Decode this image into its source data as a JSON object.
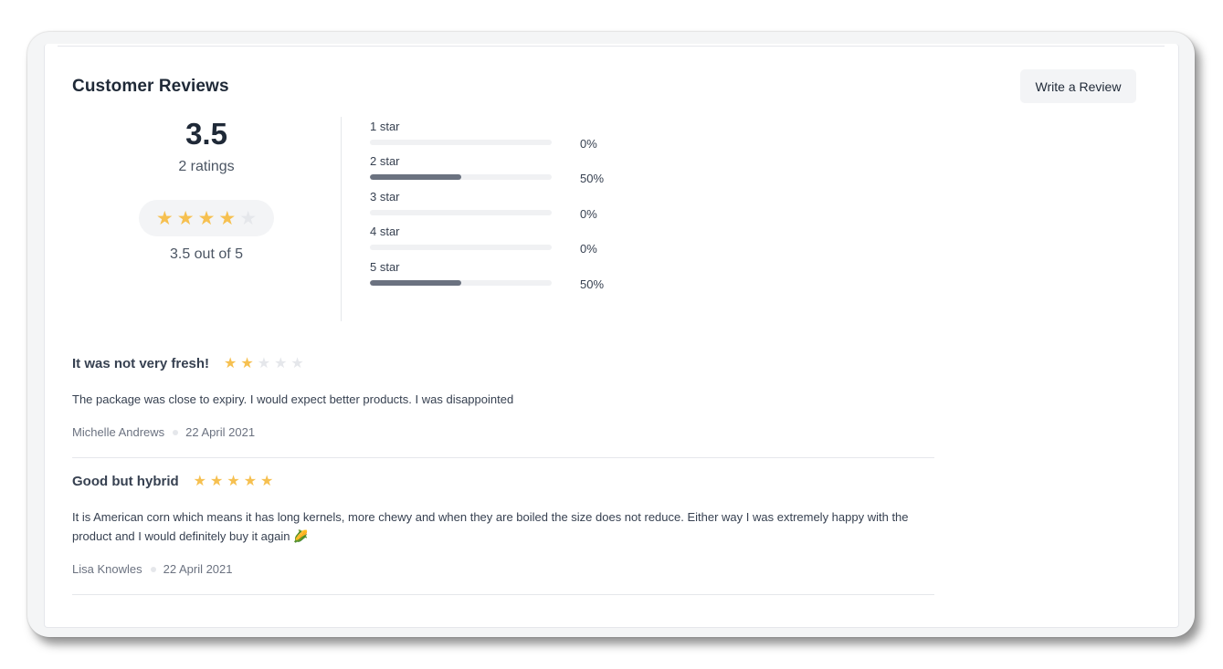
{
  "header": {
    "title": "Customer Reviews",
    "write_review_label": "Write a Review"
  },
  "summary": {
    "average": "3.5",
    "ratings_count": "2 ratings",
    "stars_filled": 4,
    "stars_total": 5,
    "out_of": "3.5 out of 5"
  },
  "distribution": [
    {
      "label": "1 star",
      "percent_text": "0%",
      "percent": 0
    },
    {
      "label": "2 star",
      "percent_text": "50%",
      "percent": 50
    },
    {
      "label": "3 star",
      "percent_text": "0%",
      "percent": 0
    },
    {
      "label": "4 star",
      "percent_text": "0%",
      "percent": 0
    },
    {
      "label": "5 star",
      "percent_text": "50%",
      "percent": 50
    }
  ],
  "reviews": [
    {
      "title": "It was not very fresh!",
      "rating": 2,
      "body": "The package was close to expiry. I would expect better products. I was disappointed",
      "author": "Michelle Andrews",
      "date": "22 April 2021"
    },
    {
      "title": "Good but hybrid",
      "rating": 5,
      "body": "It is American corn which means it has long kernels, more chewy and when they are boiled the size does not reduce. Either way I was extremely happy with the product and I would definitely buy it again 🌽",
      "author": "Lisa Knowles",
      "date": "22 April 2021"
    }
  ],
  "icons": {
    "star_glyph": "★",
    "star_on_color": "#f6c050",
    "star_off_color": "#e5e7eb"
  }
}
